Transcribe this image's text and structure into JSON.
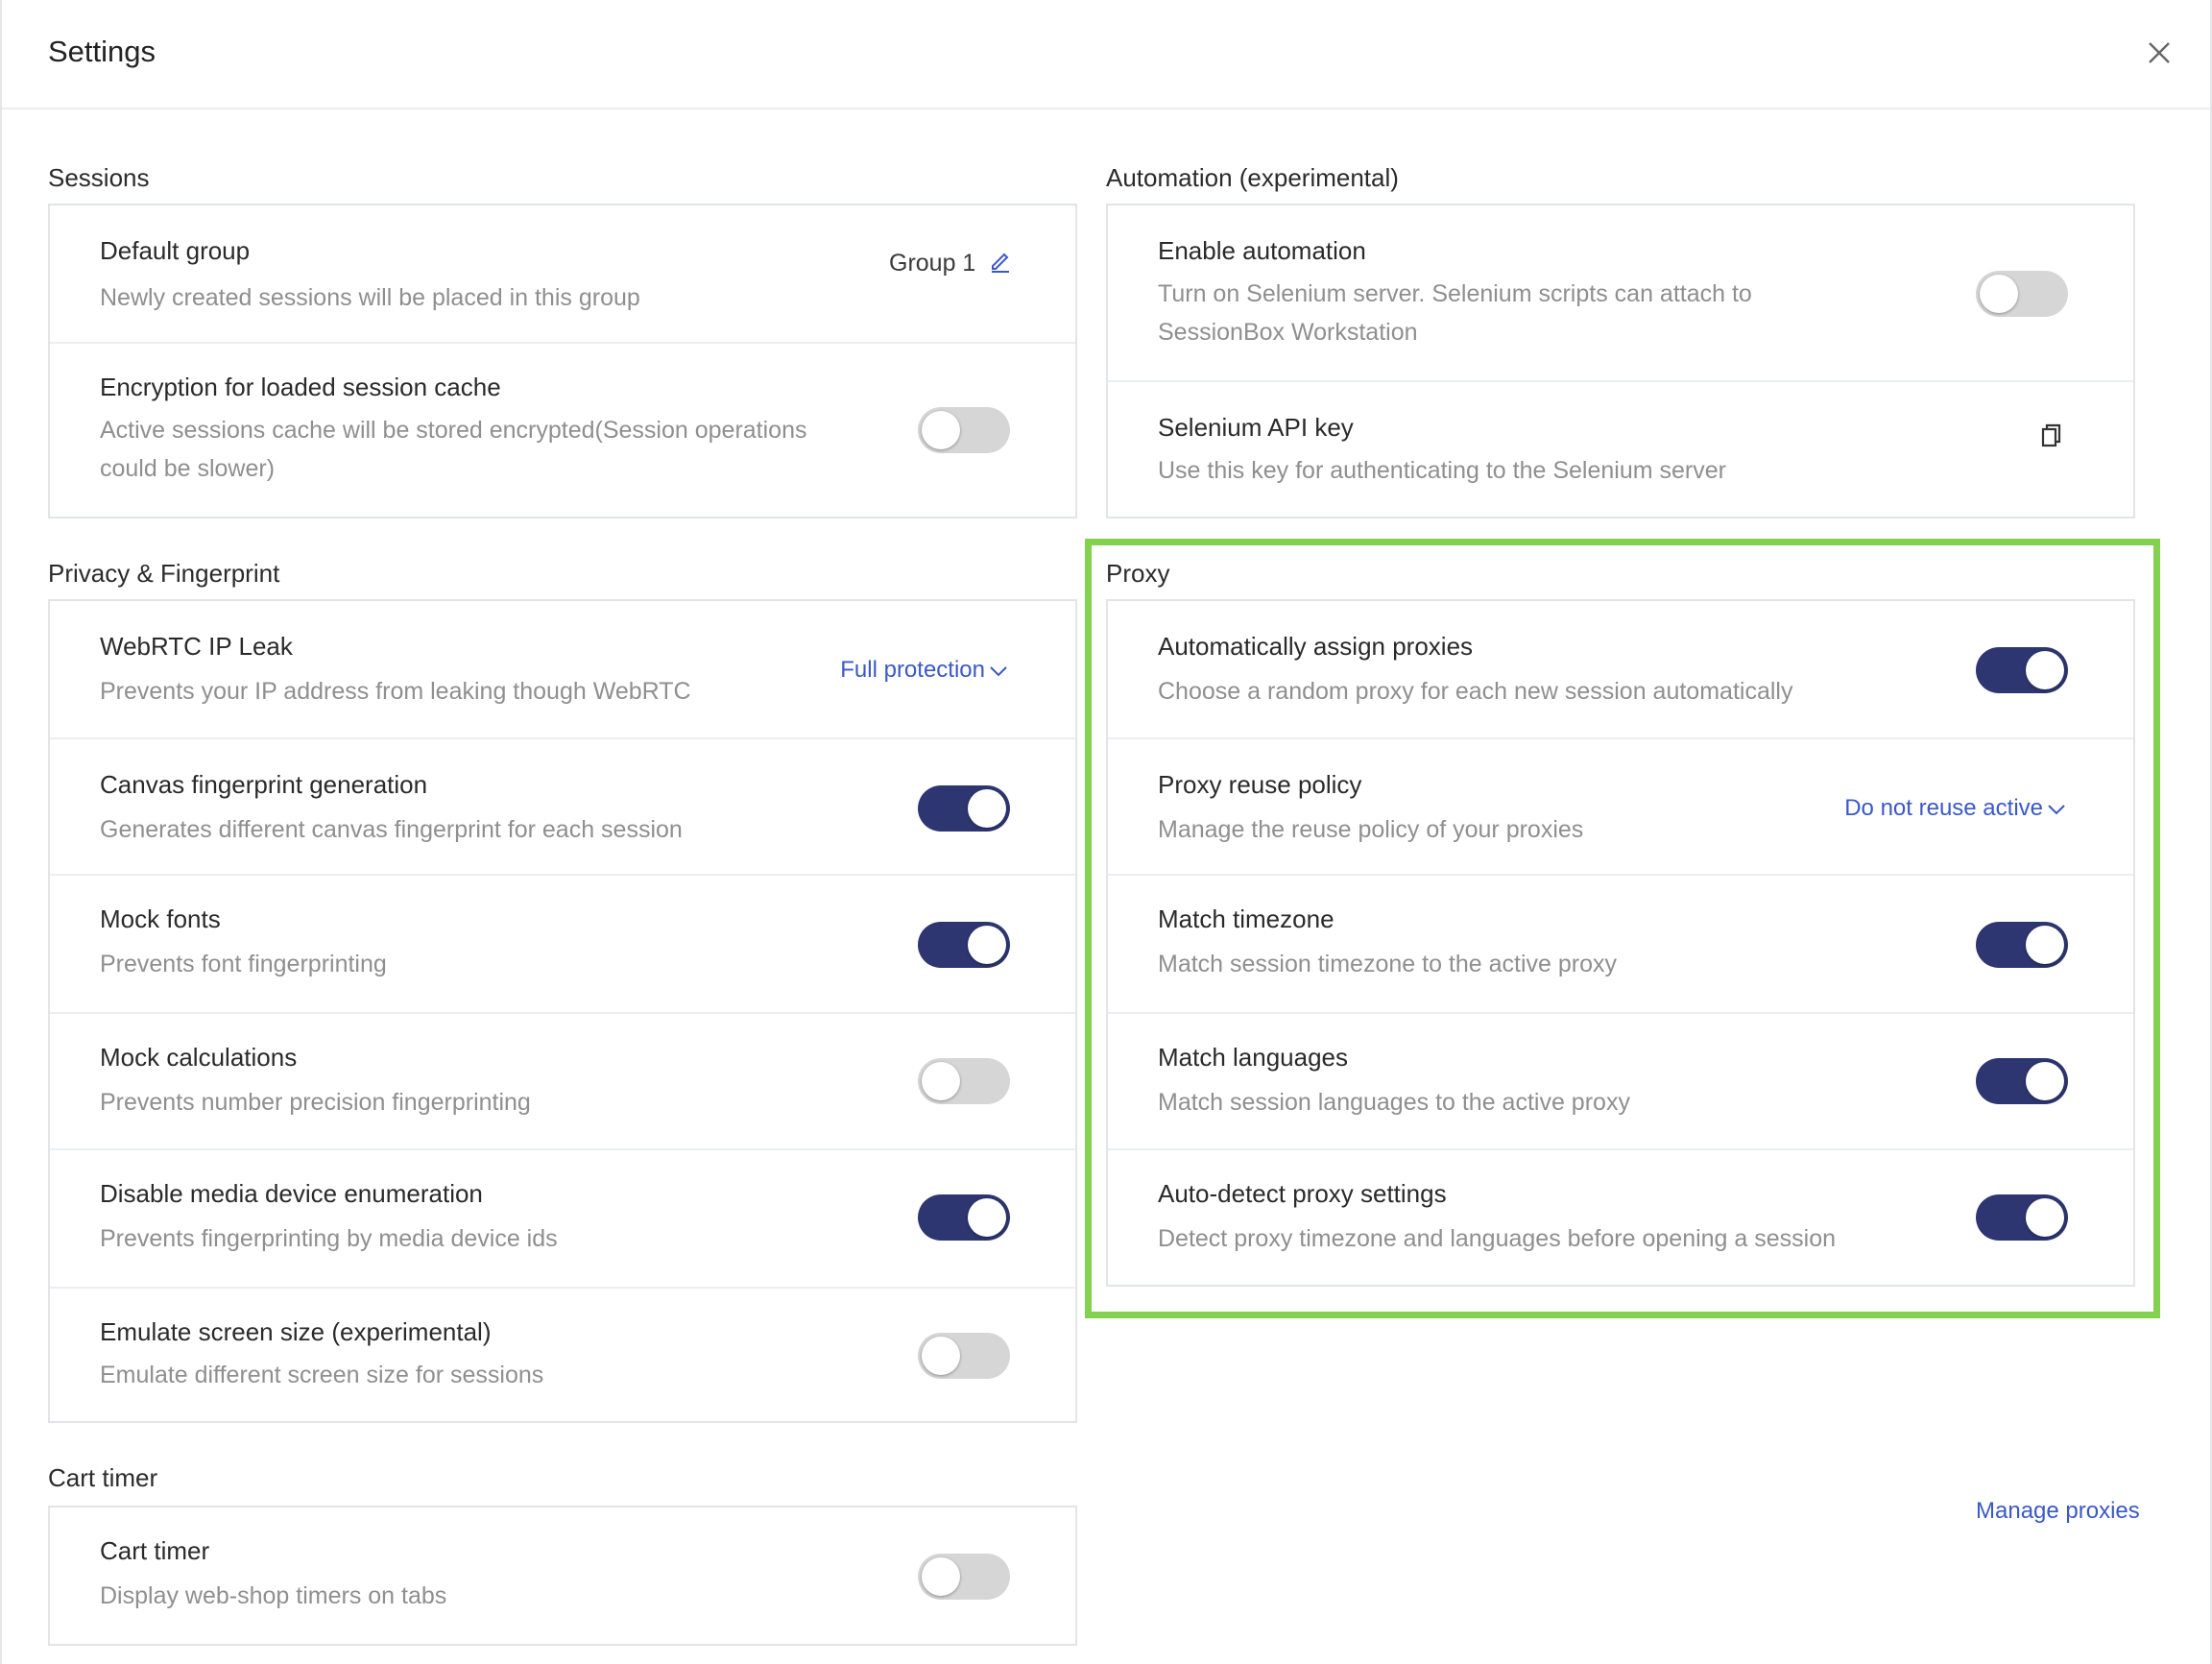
{
  "header": {
    "title": "Settings"
  },
  "sessions": {
    "title": "Sessions",
    "default_group": {
      "title": "Default group",
      "desc": "Newly created sessions will be placed in this group",
      "value": "Group 1"
    },
    "encryption": {
      "title": "Encryption for loaded session cache",
      "desc_line1": "Active sessions cache will be stored encrypted(Session operations",
      "desc_line2": "could be slower)",
      "enabled": false
    }
  },
  "automation": {
    "title": "Automation (experimental)",
    "enable": {
      "title": "Enable automation",
      "desc_line1": "Turn on Selenium server. Selenium scripts can attach to",
      "desc_line2": "SessionBox Workstation",
      "enabled": false
    },
    "api_key": {
      "title": "Selenium API key",
      "desc": "Use this key for authenticating to the Selenium server"
    }
  },
  "privacy": {
    "title": "Privacy & Fingerprint",
    "items": [
      {
        "title": "WebRTC IP Leak",
        "desc": "Prevents your IP address from leaking though WebRTC",
        "control": "dropdown",
        "value": "Full protection"
      },
      {
        "title": "Canvas fingerprint generation",
        "desc": "Generates different canvas fingerprint for each session",
        "control": "toggle",
        "enabled": true
      },
      {
        "title": "Mock fonts",
        "desc": "Prevents font fingerprinting",
        "control": "toggle",
        "enabled": true
      },
      {
        "title": "Mock calculations",
        "desc": "Prevents number precision fingerprinting",
        "control": "toggle",
        "enabled": false
      },
      {
        "title": "Disable media device enumeration",
        "desc": "Prevents fingerprinting by media device ids",
        "control": "toggle",
        "enabled": true
      },
      {
        "title": "Emulate screen size (experimental)",
        "desc": "Emulate different screen size for sessions",
        "control": "toggle",
        "enabled": false
      }
    ]
  },
  "proxy": {
    "title": "Proxy",
    "items": [
      {
        "title": "Automatically assign proxies",
        "desc": "Choose a random proxy for each new session automatically",
        "control": "toggle",
        "enabled": true
      },
      {
        "title": "Proxy reuse policy",
        "desc": "Manage the reuse policy of your proxies",
        "control": "dropdown",
        "value": "Do not reuse active"
      },
      {
        "title": "Match timezone",
        "desc": "Match session timezone to the active proxy",
        "control": "toggle",
        "enabled": true
      },
      {
        "title": "Match languages",
        "desc": "Match session languages to the active proxy",
        "control": "toggle",
        "enabled": true
      },
      {
        "title": "Auto-detect proxy settings",
        "desc": "Detect proxy timezone and languages before opening a session",
        "control": "toggle",
        "enabled": true
      }
    ],
    "manage_link": "Manage proxies"
  },
  "cart_timer": {
    "title": "Cart timer",
    "item": {
      "title": "Cart timer",
      "desc": "Display web-shop timers on tabs",
      "enabled": false
    }
  },
  "colors": {
    "toggle_on": "#2d3670",
    "toggle_off": "#d6d6d6",
    "link": "#3a58c8",
    "highlight": "#84d04f"
  },
  "icons": [
    "close-icon",
    "pencil-icon",
    "copy-icon",
    "chevron-down-icon"
  ]
}
